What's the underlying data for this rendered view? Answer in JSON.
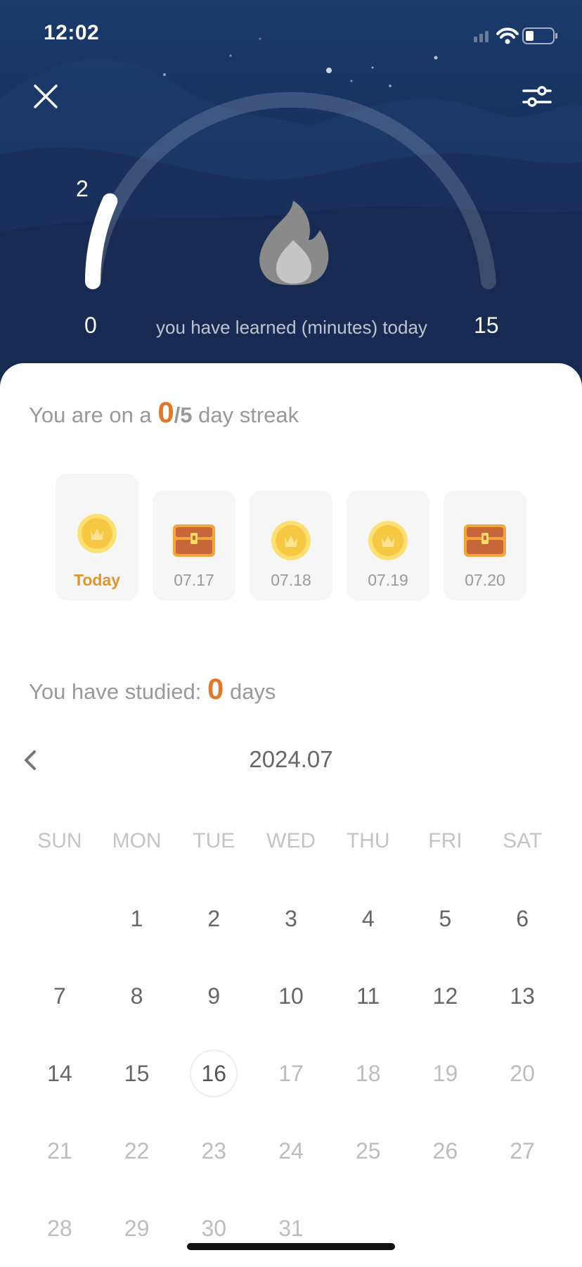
{
  "status_bar": {
    "time": "12:02"
  },
  "header": {
    "close_icon": "close-icon",
    "settings_icon": "sliders-icon"
  },
  "gauge": {
    "current_value": "2",
    "min_label": "0",
    "max_label": "15",
    "caption": "you have learned (minutes) today",
    "progress_fraction": 0.133,
    "flame_icon": "flame-icon"
  },
  "streak": {
    "prefix": "You are on a",
    "current": "0",
    "goal": "/5",
    "suffix": "day streak",
    "days": [
      {
        "label": "Today",
        "reward": "coin-icon",
        "is_today": true
      },
      {
        "label": "07.17",
        "reward": "treasure-chest-icon",
        "is_today": false
      },
      {
        "label": "07.18",
        "reward": "coin-icon",
        "is_today": false
      },
      {
        "label": "07.19",
        "reward": "coin-icon",
        "is_today": false
      },
      {
        "label": "07.20",
        "reward": "treasure-chest-icon",
        "is_today": false
      }
    ]
  },
  "studied": {
    "prefix": "You have studied:",
    "count": "0",
    "suffix": "days"
  },
  "calendar": {
    "month": "2024.07",
    "weekdays": [
      "SUN",
      "MON",
      "TUE",
      "WED",
      "THU",
      "FRI",
      "SAT"
    ],
    "today": "16",
    "weeks": [
      [
        "",
        "1",
        "2",
        "3",
        "4",
        "5",
        "6"
      ],
      [
        "7",
        "8",
        "9",
        "10",
        "11",
        "12",
        "13"
      ],
      [
        "14",
        "15",
        "16",
        "17",
        "18",
        "19",
        "20"
      ],
      [
        "21",
        "22",
        "23",
        "24",
        "25",
        "26",
        "27"
      ],
      [
        "28",
        "29",
        "30",
        "31",
        "",
        "",
        ""
      ]
    ]
  },
  "colors": {
    "accent": "#e07a2b",
    "hero_bg": "#17305e"
  }
}
